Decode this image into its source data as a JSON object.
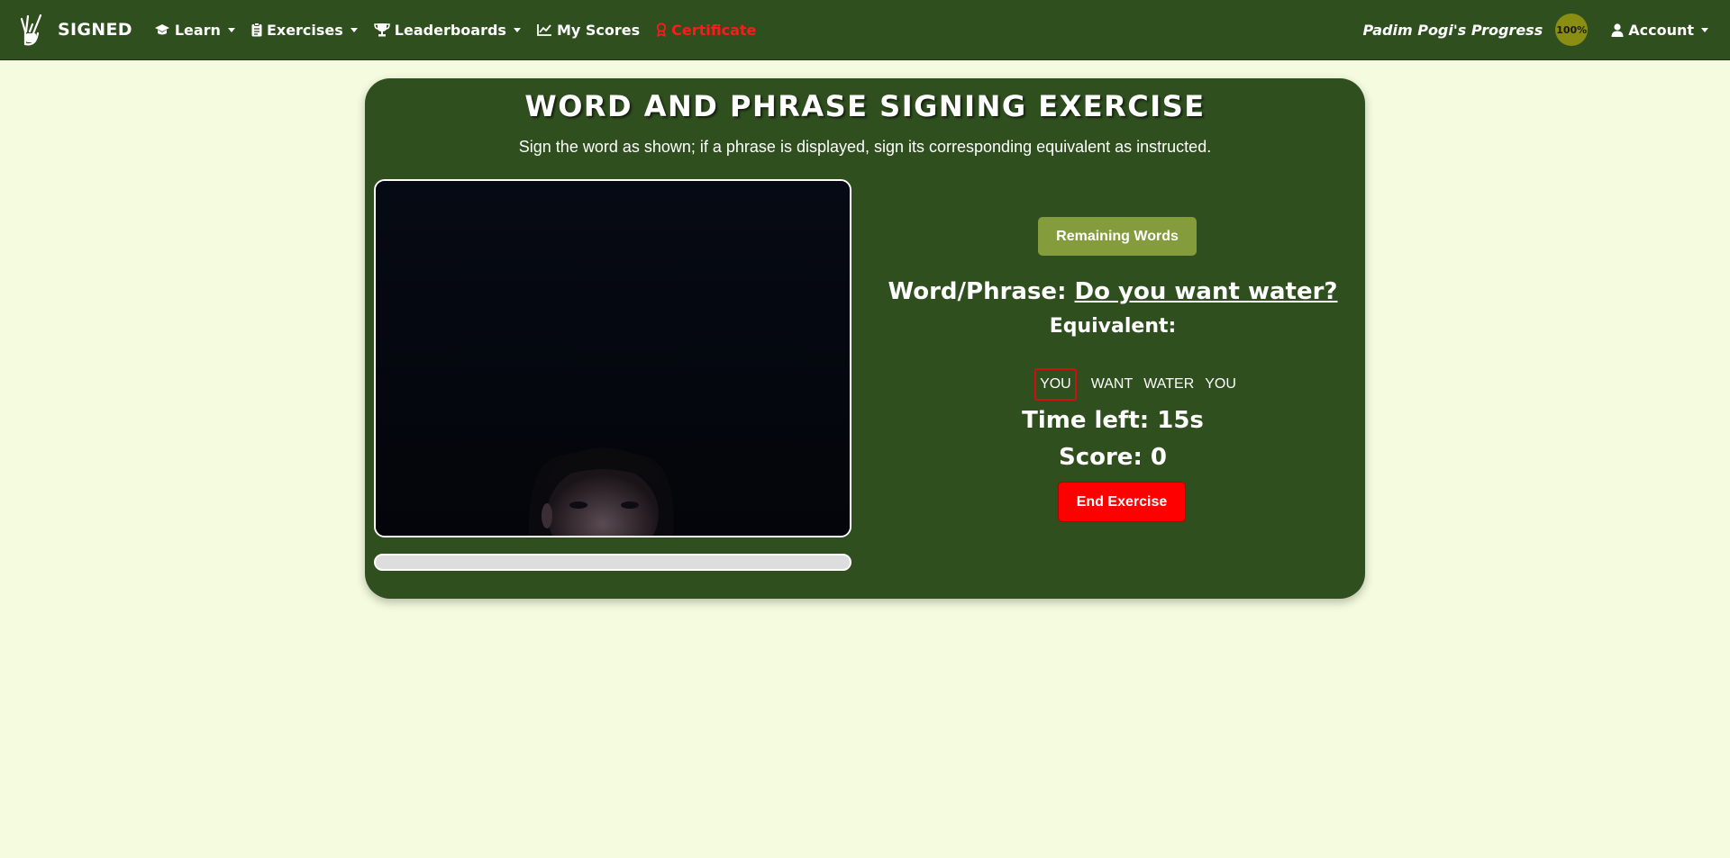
{
  "navbar": {
    "brand": "SIGNED",
    "brand_icon": "sign-hand-logo",
    "items": [
      {
        "label": "Learn",
        "icon": "graduation-cap-icon",
        "dropdown": true
      },
      {
        "label": "Exercises",
        "icon": "clipboard-icon",
        "dropdown": true
      },
      {
        "label": "Leaderboards",
        "icon": "trophy-icon",
        "dropdown": true
      },
      {
        "label": "My Scores",
        "icon": "line-chart-icon",
        "dropdown": false
      },
      {
        "label": "Certificate",
        "icon": "award-icon",
        "dropdown": false,
        "color": "#ff1a1a"
      }
    ],
    "progress_label": "Padim Pogi's Progress",
    "progress_value": "100%",
    "account_label": "Account"
  },
  "exercise": {
    "title": "WORD AND PHRASE SIGNING EXERCISE",
    "subtitle": "Sign the word as shown; if a phrase is displayed, sign its corresponding equivalent as instructed.",
    "remaining_button": "Remaining Words",
    "word_label": "Word/Phrase:",
    "word_value": "Do you want water?",
    "equivalent_label": "Equivalent:",
    "tokens": [
      "YOU",
      "WANT",
      "WATER",
      "YOU"
    ],
    "active_token_index": 0,
    "time_label": "Time left:",
    "time_value": "15s",
    "score_label": "Score:",
    "score_value": "0",
    "end_button": "End Exercise",
    "loader_progress": 0
  },
  "colors": {
    "nav_bg": "#2f4f1f",
    "page_bg": "#f4fbdf",
    "card_bg": "#2f4f1f",
    "remaining_btn": "#859c3d",
    "end_btn": "#ff0000",
    "active_token_border": "#d01010",
    "certificate": "#ff1a1a"
  }
}
